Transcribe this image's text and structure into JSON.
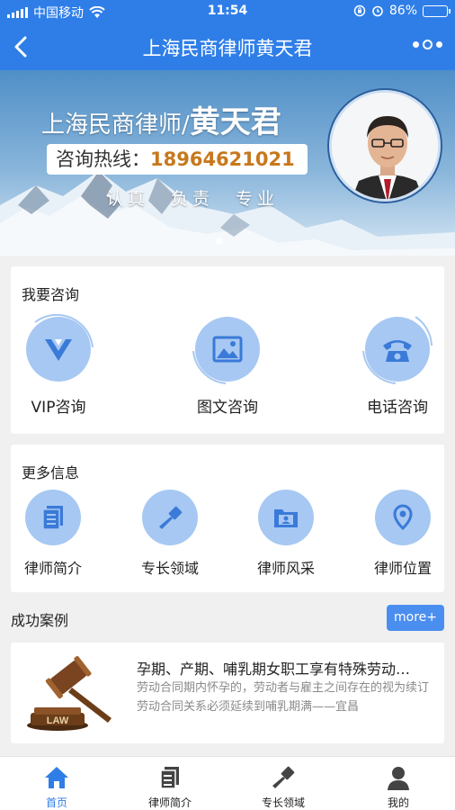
{
  "status_bar": {
    "carrier": "中国移动",
    "time": "11:54",
    "battery_text": "86%",
    "battery_level": 0.86
  },
  "nav": {
    "title": "上海民商律师黄天君",
    "back_icon": "chevron-left-icon",
    "more_icon": "more-dots-icon"
  },
  "banner": {
    "headline_prefix": "上海民商律师/",
    "headline_name": "黄天君",
    "hotline_label": "咨询热线：",
    "hotline_number": "18964621021",
    "motto": "认真　负责　专业"
  },
  "consult": {
    "title": "我要咨询",
    "items": [
      {
        "label": "VIP咨询",
        "icon": "vip-icon"
      },
      {
        "label": "图文咨询",
        "icon": "image-icon"
      },
      {
        "label": "电话咨询",
        "icon": "phone-icon"
      }
    ]
  },
  "info": {
    "title": "更多信息",
    "items": [
      {
        "label": "律师简介",
        "icon": "document-icon"
      },
      {
        "label": "专长领域",
        "icon": "gavel-icon"
      },
      {
        "label": "律师风采",
        "icon": "folder-profile-icon"
      },
      {
        "label": "律师位置",
        "icon": "location-pin-icon"
      }
    ]
  },
  "cases": {
    "title": "成功案例",
    "more_label": "more+",
    "items": [
      {
        "title": "孕期、产期、哺乳期女职工享有特殊劳动…",
        "desc": "劳动合同期内怀孕的，劳动者与雇主之间存在的视为续订劳动合同关系必须延续到哺乳期满——宜昌",
        "thumb_label": "LAW"
      }
    ]
  },
  "tabbar": {
    "items": [
      {
        "label": "首页",
        "icon": "home-icon",
        "active": true
      },
      {
        "label": "律师简介",
        "icon": "document-icon",
        "active": false
      },
      {
        "label": "专长领域",
        "icon": "gavel-icon",
        "active": false
      },
      {
        "label": "我的",
        "icon": "user-icon",
        "active": false
      }
    ]
  },
  "colors": {
    "primary": "#2f7ee8",
    "icon_bg": "#a7c8f2",
    "icon_fg": "#3a7ad8",
    "accent_number": "#c7781c",
    "more_button": "#4a8ef0"
  }
}
